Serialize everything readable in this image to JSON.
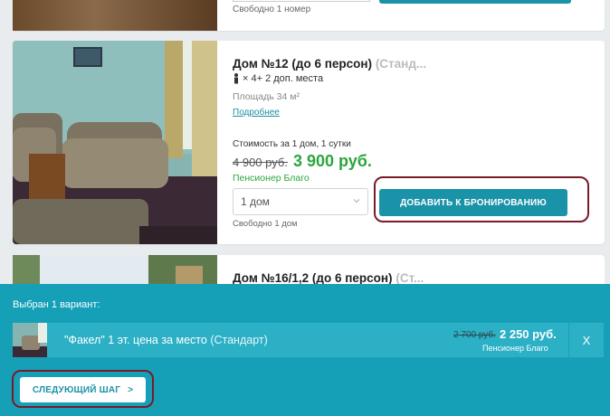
{
  "top_card": {
    "availability": "Свободно 1 номер"
  },
  "room": {
    "title": "Дом №12 (до 6 персон)",
    "category": "(Станд...",
    "places": "× 4+ 2 доп. места",
    "area": "Площадь 34 м²",
    "more_link": "Подробнее",
    "cost_label": "Стоимость за 1 дом, 1 сутки",
    "old_price": "4 900 руб.",
    "new_price": "3 900 руб.",
    "tariff": "Пенсионер Благо",
    "quantity_value": "1 дом",
    "availability": "Свободно 1 дом",
    "add_button": "ДОБАВИТЬ К БРОНИРОВАНИЮ"
  },
  "next_room": {
    "title": "Дом №16/1,2 (до 6 персон)",
    "category": "(Ст..."
  },
  "selection_panel": {
    "header": "Выбран 1 вариант:",
    "item": {
      "name": "\"Факел\" 1 эт. цена за место",
      "category": "(Стандарт)",
      "old_price": "2 700 руб.",
      "new_price": "2 250 руб.",
      "tariff": "Пенсионер Благо",
      "close": "X"
    },
    "next_button": "СЛЕДУЮЩИЙ ШАГ",
    "next_chevron": ">"
  },
  "colors": {
    "accent": "#1a93a8",
    "panel": "#16a0b8",
    "price_green": "#2aa63d",
    "highlight_ring": "#7a1a2a"
  }
}
